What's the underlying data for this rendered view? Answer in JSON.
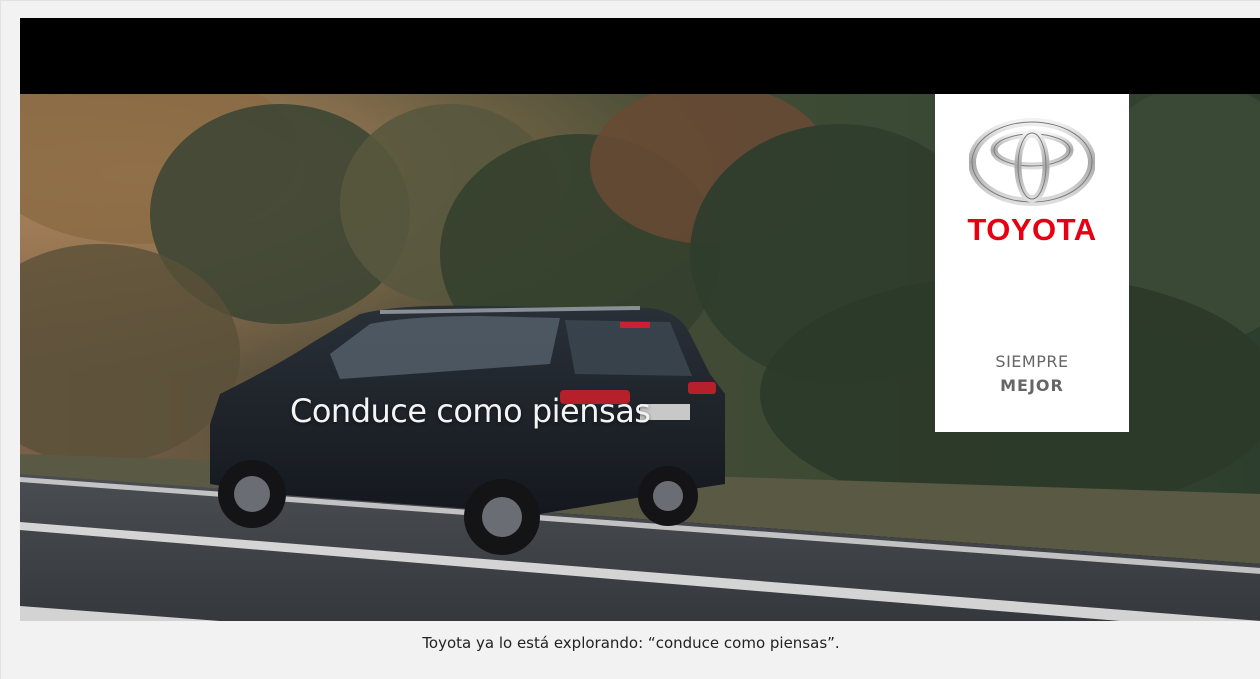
{
  "media": {
    "overlay_text": "Conduce como piensas",
    "brand": {
      "name": "TOYOTA",
      "slogan_line1": "SIEMPRE",
      "slogan_line2": "MEJOR",
      "brand_color": "#e60012"
    }
  },
  "figure": {
    "caption": "Toyota ya lo está explorando: “conduce como piensas”."
  }
}
